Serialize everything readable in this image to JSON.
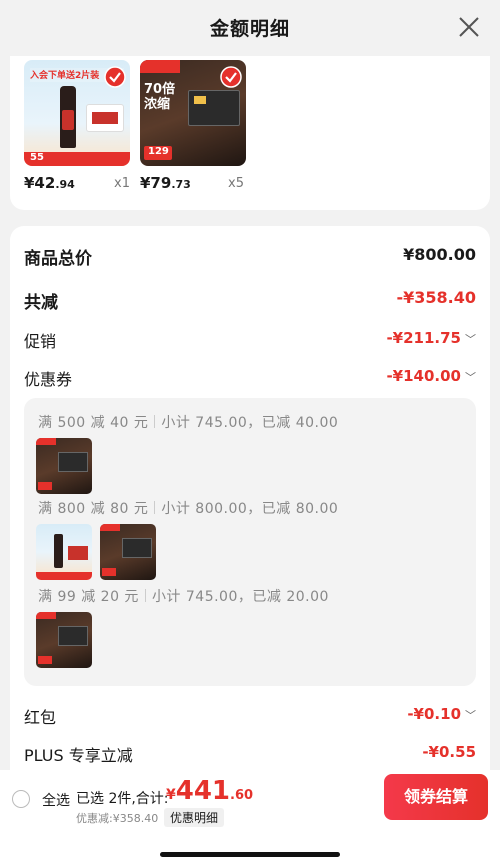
{
  "header": {
    "title": "金额明细"
  },
  "products": [
    {
      "price_int": "¥42",
      "price_dec": ".94",
      "qty": "x1",
      "image_text": "入会下单送2片装",
      "badge": "55"
    },
    {
      "price_int": "¥79",
      "price_dec": ".73",
      "qty": "x5",
      "image_text": "70倍浓缩",
      "badge": "129"
    }
  ],
  "summary": {
    "total_label": "商品总价",
    "total_value": "¥800.00",
    "reduce_label": "共减",
    "reduce_value": "-¥358.40",
    "promo_label": "促销",
    "promo_value": "-¥211.75",
    "coupon_label": "优惠券",
    "coupon_value": "-¥140.00",
    "hongbao_label": "红包",
    "hongbao_value": "-¥0.10",
    "plus_label": "PLUS 专享立减",
    "plus_value": "-¥0.55"
  },
  "coupons": [
    {
      "rule": "满 500 减 40 元",
      "detail": "小计 745.00，已减 40.00"
    },
    {
      "rule": "满 800 减 80 元",
      "detail": "小计 800.00，已减 80.00"
    },
    {
      "rule": "满 99 减 20 元",
      "detail": "小计 745.00，已减 20.00"
    }
  ],
  "bottom": {
    "select_all": "全选",
    "selected": "已选 2件,合计:",
    "currency": "¥",
    "total_int": "441",
    "total_dec": ".60",
    "discount": "优惠减:¥358.40",
    "detail_link": "优惠明细",
    "checkout": "领券结算"
  },
  "colors": {
    "accent": "#e5312b",
    "background": "#f2f2f2"
  }
}
